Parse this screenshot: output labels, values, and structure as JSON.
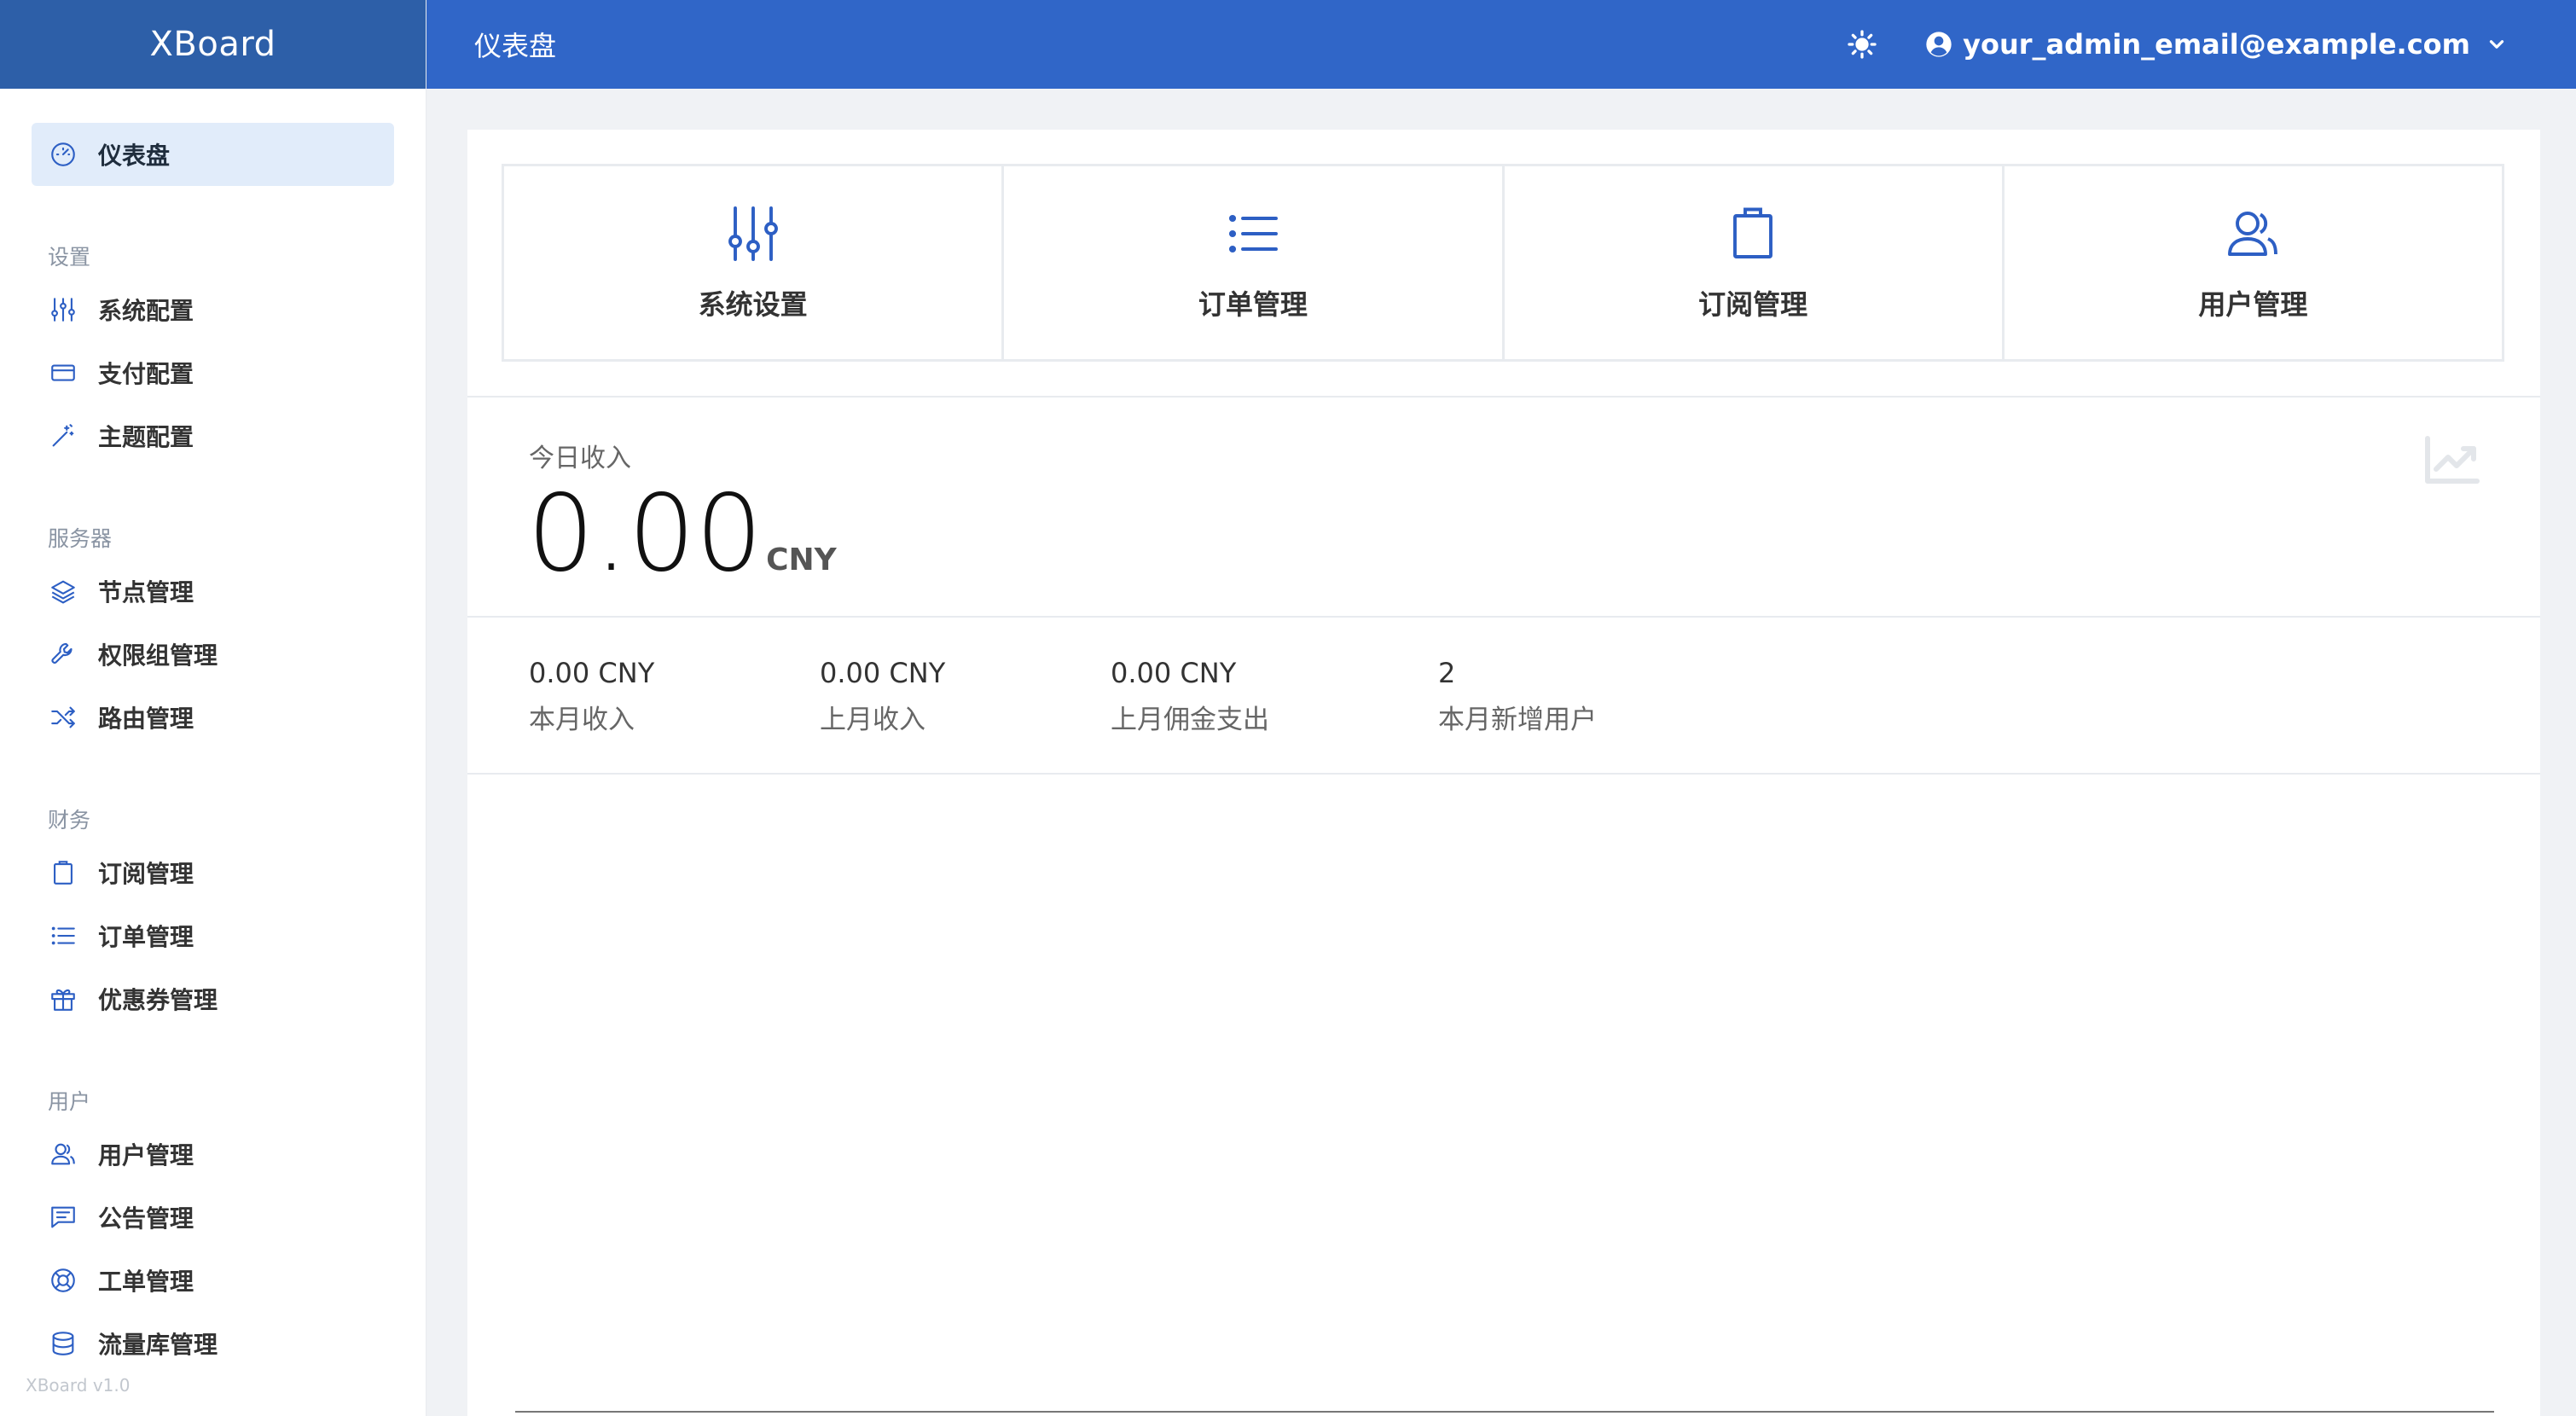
{
  "app": {
    "name": "XBoard"
  },
  "footer": {
    "version_text": "XBoard v1.0"
  },
  "header": {
    "title": "仪表盘",
    "theme_icon": "sun-icon",
    "user_email": "your_admin_email@example.com"
  },
  "sidebar": {
    "dashboard": {
      "label": "仪表盘",
      "icon": "dashboard-icon"
    },
    "sections": [
      {
        "title": "设置",
        "items": [
          {
            "label": "系统配置",
            "icon": "sliders-icon"
          },
          {
            "label": "支付配置",
            "icon": "credit-card-icon"
          },
          {
            "label": "主题配置",
            "icon": "magic-wand-icon"
          }
        ]
      },
      {
        "title": "服务器",
        "items": [
          {
            "label": "节点管理",
            "icon": "layers-icon"
          },
          {
            "label": "权限组管理",
            "icon": "wrench-icon"
          },
          {
            "label": "路由管理",
            "icon": "shuffle-icon"
          }
        ]
      },
      {
        "title": "财务",
        "items": [
          {
            "label": "订阅管理",
            "icon": "clipboard-icon"
          },
          {
            "label": "订单管理",
            "icon": "list-icon"
          },
          {
            "label": "优惠券管理",
            "icon": "gift-icon"
          }
        ]
      },
      {
        "title": "用户",
        "items": [
          {
            "label": "用户管理",
            "icon": "users-icon"
          },
          {
            "label": "公告管理",
            "icon": "chat-icon"
          },
          {
            "label": "工单管理",
            "icon": "lifebuoy-icon"
          },
          {
            "label": "流量库管理",
            "icon": "database-icon"
          }
        ]
      }
    ]
  },
  "tiles": [
    {
      "label": "系统设置",
      "icon": "sliders-icon"
    },
    {
      "label": "订单管理",
      "icon": "list-icon"
    },
    {
      "label": "订阅管理",
      "icon": "clipboard-icon"
    },
    {
      "label": "用户管理",
      "icon": "users-icon"
    }
  ],
  "today": {
    "label": "今日收入",
    "value": "0.00",
    "unit": "CNY",
    "icon": "trend-chart-icon"
  },
  "stats": [
    {
      "value": "0.00 CNY",
      "label": "本月收入"
    },
    {
      "value": "0.00 CNY",
      "label": "上月收入"
    },
    {
      "value": "0.00 CNY",
      "label": "上月佣金支出"
    },
    {
      "value": "2",
      "label": "本月新增用户"
    }
  ],
  "colors": {
    "header_bg": "#3066c8",
    "logo_bg": "#2d5fa8",
    "accent": "#2d5fc4",
    "active_bg": "#e1ecfa"
  }
}
